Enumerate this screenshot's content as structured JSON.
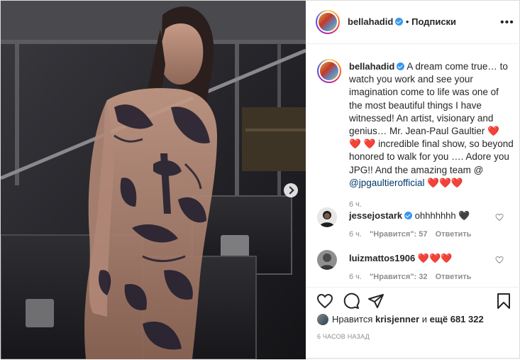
{
  "post": {
    "username": "bellahadid",
    "separator": "•",
    "follow_label": "Подписки",
    "more_label": "•••",
    "caption": {
      "username": "bellahadid",
      "text_1": "A dream come true… to watch you work and see your imagination come to life was one of the most beautiful things I have witnessed! An artist, visionary and genius… Mr. Jean-Paul Gaultier",
      "emoji_1": "❤️ ❤️",
      "emoji_2": "❤️",
      "text_2": "incredible final show, so beyond honored to walk for you …. Adore you JPG!! And the amazing team @",
      "mention": "@jpgaultierofficial",
      "emoji_3": "❤️❤️❤️",
      "time": "6 ч."
    },
    "comments": [
      {
        "username": "jessejostark",
        "text": "ohhhhhhh 🖤",
        "time": "6 ч.",
        "likes": "\"Нравится\": 57",
        "reply": "Ответить"
      },
      {
        "username": "luizmattos1906",
        "text": "❤️❤️❤️",
        "time": "6 ч.",
        "likes": "\"Нравится\": 32",
        "reply": "Ответить"
      }
    ],
    "likes_line": {
      "prefix": "Нравится",
      "user": "krisjenner",
      "middle": "и",
      "count": "ещё 681 322"
    },
    "time_ago": "6 ЧАСОВ НАЗАД"
  },
  "colors": {
    "verified": "#3897f0",
    "link": "#00376b",
    "meta": "#8e8e8e"
  },
  "icons": [
    "heart-icon",
    "comment-icon",
    "share-icon",
    "save-icon",
    "more-icon",
    "next-arrow-icon",
    "verified-icon",
    "like-comment-icon"
  ]
}
